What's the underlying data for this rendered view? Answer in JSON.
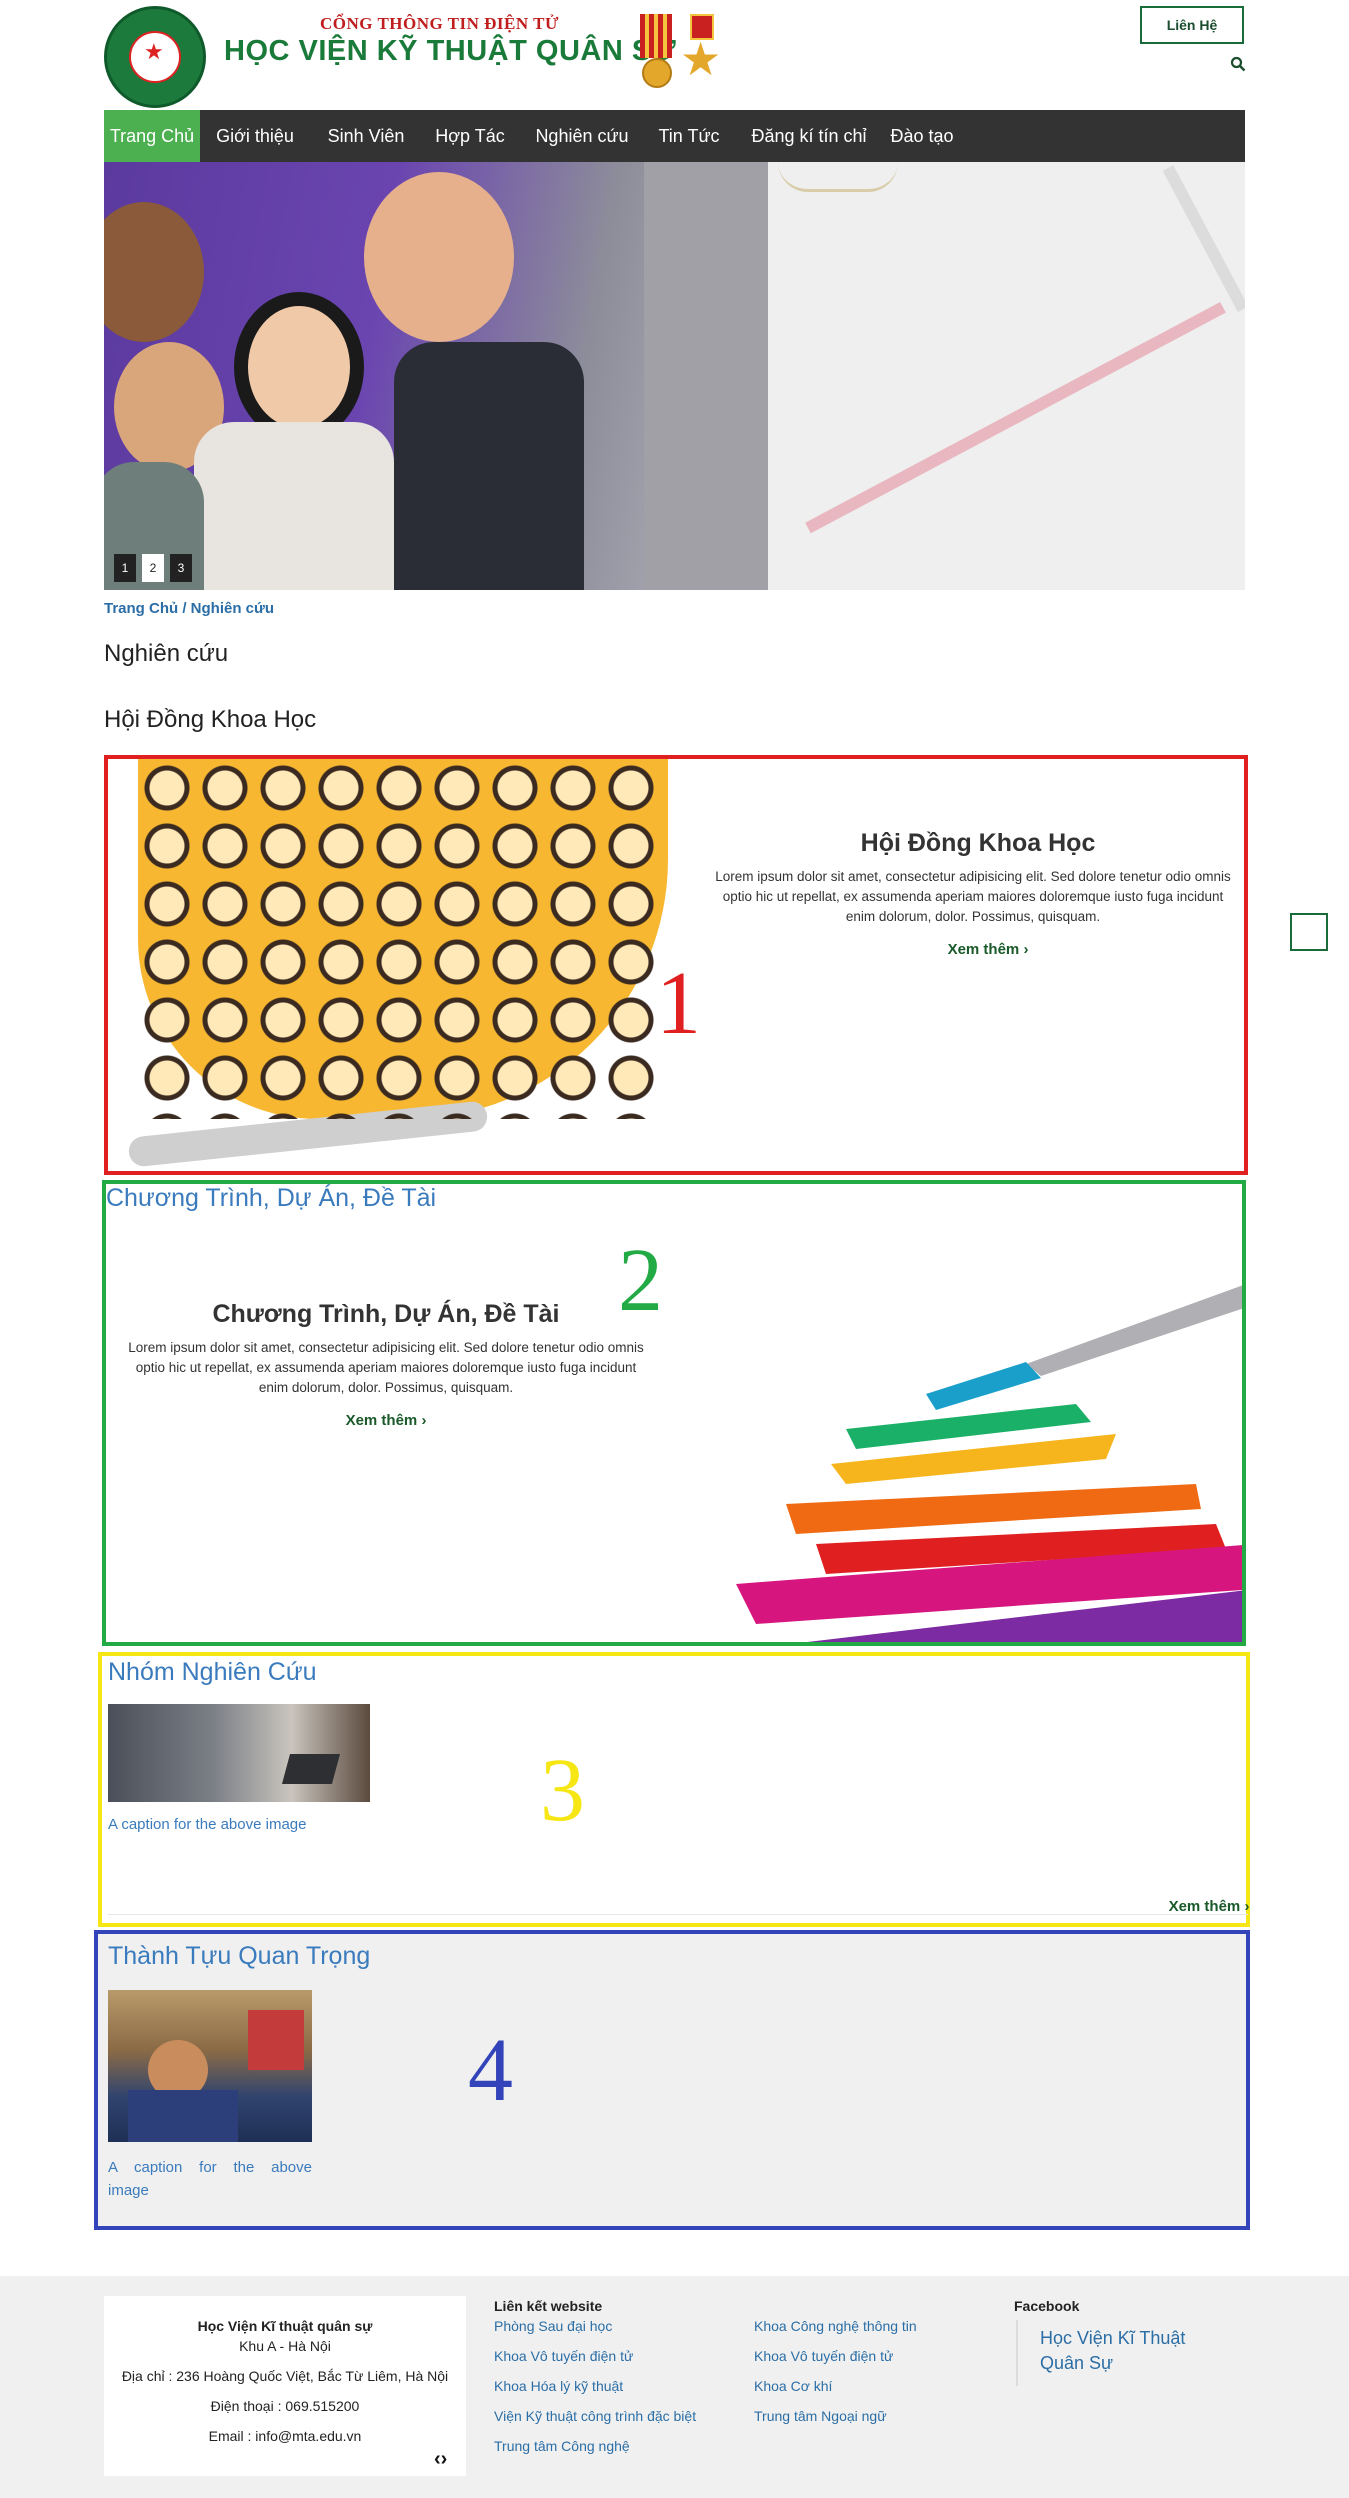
{
  "header": {
    "subtitle": "CỔNG THÔNG TIN ĐIỆN TỬ",
    "title": "HỌC VIỆN KỸ THUẬT QUÂN SỰ",
    "contact_label": "Liên Hệ"
  },
  "nav": {
    "items": [
      {
        "label": "Trang Chủ",
        "active": true
      },
      {
        "label": "Giới thiệu"
      },
      {
        "label": "Sinh Viên"
      },
      {
        "label": "Hợp Tác"
      },
      {
        "label": "Nghiên cứu"
      },
      {
        "label": "Tin Tức"
      },
      {
        "label": "Đăng kí tín chỉ"
      },
      {
        "label": "Đào tạo"
      }
    ]
  },
  "slider": {
    "pages": [
      "1",
      "2",
      "3"
    ],
    "active_page": "2"
  },
  "breadcrumb": "Trang Chủ / Nghiên cứu",
  "page_title": "Nghiên cứu",
  "section_heading": "Hội Đồng Khoa Học",
  "sections": [
    {
      "marker": "1",
      "marker_color": "#e02020",
      "title": "Hội Đồng Khoa Học",
      "text": "Lorem ipsum dolor sit amet, consectetur adipisicing elit. Sed dolore tenetur odio omnis optio hic ut repellat, ex assumenda aperiam maiores doloremque iusto fuga incidunt enim dolorum, dolor. Possimus, quisquam.",
      "more_label": "Xem thêm"
    },
    {
      "marker": "2",
      "marker_color": "#22aa44",
      "heading": "Chương Trình, Dự Án, Đề Tài",
      "title": "Chương Trình, Dự Án, Đề Tài",
      "text": "Lorem ipsum dolor sit amet, consectetur adipisicing elit. Sed dolore tenetur odio omnis optio hic ut repellat, ex assumenda aperiam maiores doloremque iusto fuga incidunt enim dolorum, dolor. Possimus, quisquam.",
      "more_label": "Xem thêm"
    },
    {
      "marker": "3",
      "marker_color": "#f5e614",
      "heading": "Nhóm Nghiên Cứu",
      "caption": "A caption for the above image",
      "more_label": "Xem thêm"
    },
    {
      "marker": "4",
      "marker_color": "#3344bb",
      "heading": "Thành Tựu Quan Trọng",
      "caption": "A caption for the above image"
    }
  ],
  "footer": {
    "org_name": "Học Viện Kĩ thuật quân sự",
    "area": "Khu A - Hà Nội",
    "address": "Địa chỉ : 236 Hoàng Quốc Việt, Bắc Từ Liêm, Hà Nội",
    "phone": "Điện thoại : 069.515200",
    "email": "Email : info@mta.edu.vn",
    "links_heading": "Liên kết website",
    "links_col1": [
      "Phòng Sau đại học",
      "Khoa Vô tuyến điện tử",
      "Khoa Hóa lý kỹ thuật",
      "Viện Kỹ thuật công trình đặc biệt",
      "Trung tâm Công nghệ"
    ],
    "links_col2": [
      "Khoa Công nghệ thông tin",
      "Khoa Vô tuyến điện tử",
      "Khoa Cơ khí",
      "Trung tâm Ngoại ngữ"
    ],
    "facebook_heading": "Facebook",
    "facebook_link": "Học Viện Kĩ Thuật Quân Sự",
    "code_icon": "‹›"
  },
  "colors": {
    "brand_green": "#1a7a3a",
    "nav_bg": "#333333",
    "nav_active": "#4caf50",
    "link_blue": "#2b6ea6"
  }
}
